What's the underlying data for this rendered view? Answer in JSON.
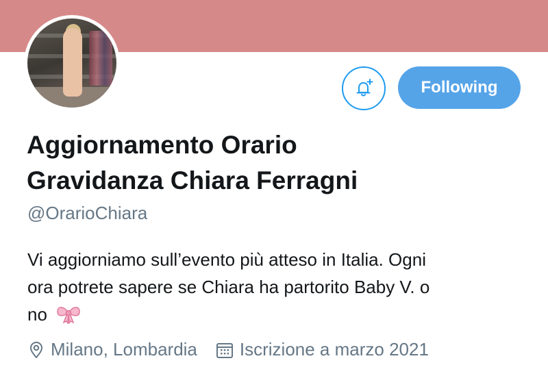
{
  "profile": {
    "display_name_line1": "Aggiornamento Orario",
    "display_name_line2": "Gravidanza Chiara Ferragni",
    "handle": "@OrarioChiara",
    "bio_line1": "Vi aggiorniamo sull’evento più atteso in Italia. Ogni",
    "bio_line2": "ora potrete sapere se Chiara ha partorito Baby V. o",
    "bio_line3": "no",
    "bio_emoji": "bow-icon",
    "location": "Milano, Lombardia",
    "location_icon": "location-pin-icon",
    "joined": "Iscrizione a marzo 2021",
    "joined_icon": "calendar-icon"
  },
  "actions": {
    "notifications_icon": "bell-plus-icon",
    "following_label": "Following"
  },
  "colors": {
    "banner": "#d58a89",
    "accent": "#1d9bf0",
    "following_bg": "#55a4e8",
    "secondary_text": "#657786"
  }
}
